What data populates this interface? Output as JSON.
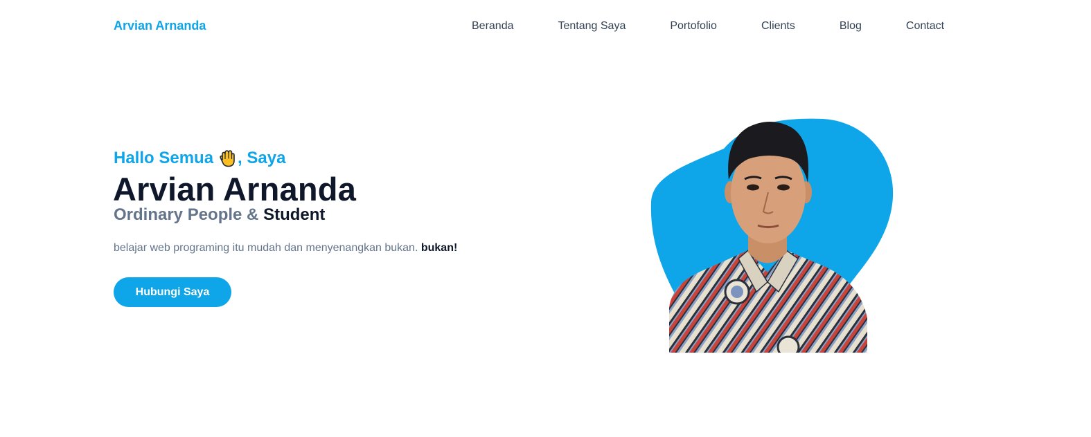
{
  "brand": "Arvian Arnanda",
  "nav": [
    {
      "label": "Beranda"
    },
    {
      "label": "Tentang Saya"
    },
    {
      "label": "Portofolio"
    },
    {
      "label": "Clients"
    },
    {
      "label": "Blog"
    },
    {
      "label": "Contact"
    }
  ],
  "hero": {
    "greeting_prefix": "Hallo Semua",
    "greeting_suffix": ", Saya",
    "greeting_icon": "waving-hand-icon",
    "name": "Arvian Arnanda",
    "subtitle_prefix": "Ordinary People & ",
    "subtitle_strong": "Student",
    "description": "belajar web programing itu mudah dan menyenangkan bukan. ",
    "description_strong": "bukan!",
    "cta_label": "Hubungi Saya",
    "photo_icon": "profile-photo"
  },
  "colors": {
    "accent": "#0ea5e9",
    "heading": "#0f172a",
    "muted": "#64748b",
    "nav_text": "#334155"
  }
}
